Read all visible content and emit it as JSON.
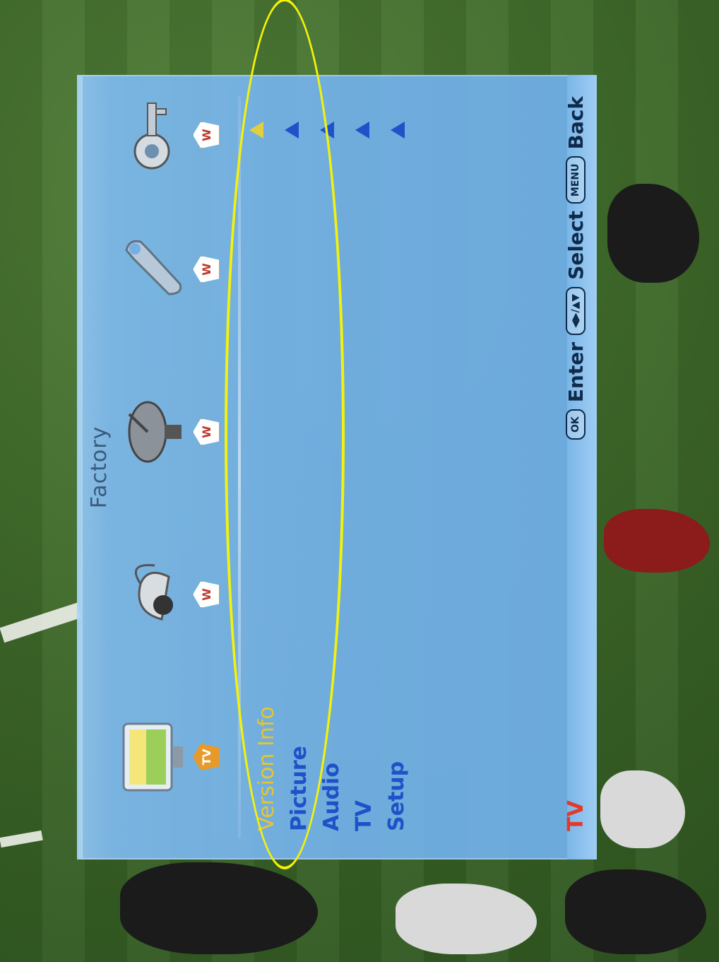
{
  "osd": {
    "title": "Factory",
    "source_label": "TV",
    "icons": [
      {
        "name": "tv-picture-icon",
        "badge": "TV",
        "active": true
      },
      {
        "name": "audio-speaker-icon",
        "badge": "W",
        "active": false
      },
      {
        "name": "satellite-dish-icon",
        "badge": "W",
        "active": false
      },
      {
        "name": "wrench-icon",
        "badge": "W",
        "active": false
      },
      {
        "name": "key-icon",
        "badge": "W",
        "active": false
      }
    ],
    "menu_items": [
      "Version Info",
      "Picture",
      "Audio",
      "TV",
      "Setup"
    ],
    "selected_index": 0,
    "footer": {
      "ok_key": "OK",
      "enter_label": "Enter",
      "nav_key": "◀▶/▲▼",
      "select_label": "Select",
      "menu_key": "MENU",
      "back_label": "Back"
    }
  },
  "colors": {
    "panel": "#72b0e6",
    "menu_text": "#1f52c8",
    "selected_text": "#e6c533",
    "source_label": "#e23a2a",
    "annotation": "#f4f20a"
  }
}
